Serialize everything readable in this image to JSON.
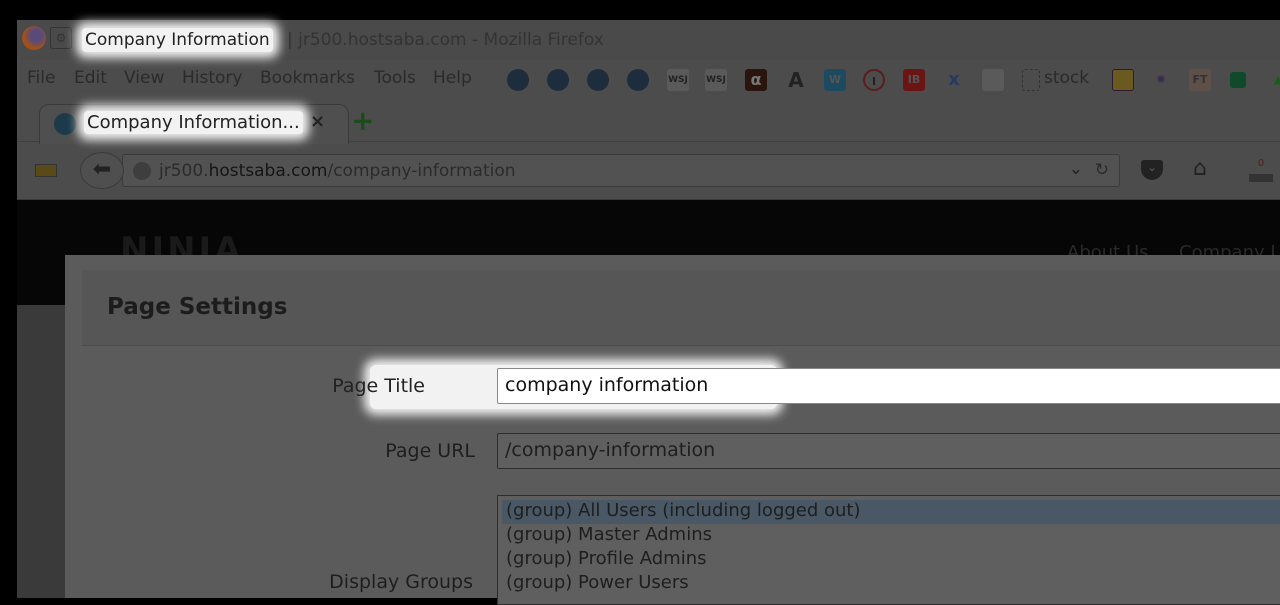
{
  "window": {
    "title_page": "Company Information",
    "title_rest": "| jr500.hostsaba.com - Mozilla Firefox"
  },
  "menu": [
    "File",
    "Edit",
    "View",
    "History",
    "Bookmarks",
    "Tools",
    "Help"
  ],
  "bookmarks": {
    "stock_label": "stock",
    "wsj1": "WSJ",
    "wsj2": "WSJ",
    "alpha": "α",
    "a": "A",
    "ib": "IB",
    "ft": "FT"
  },
  "tab": {
    "label": "Company Information...",
    "close": "×",
    "new_tab": "+"
  },
  "nav": {
    "url_prefix": "jr500.",
    "url_domain": "hostsaba.com",
    "url_path": "/company-information",
    "notif_count": "0"
  },
  "site": {
    "logo": "NINJA",
    "nav": [
      "About Us",
      "Company I"
    ]
  },
  "modal": {
    "title": "Page Settings",
    "page_title_label": "Page Title",
    "page_title_value": "company information",
    "page_url_label": "Page URL",
    "page_url_value": "/company-information",
    "display_groups_label": "Display Groups",
    "groups": [
      "(group) All Users (including logged out)",
      "(group) Master Admins",
      "(group) Profile Admins",
      "(group) Power Users"
    ]
  }
}
